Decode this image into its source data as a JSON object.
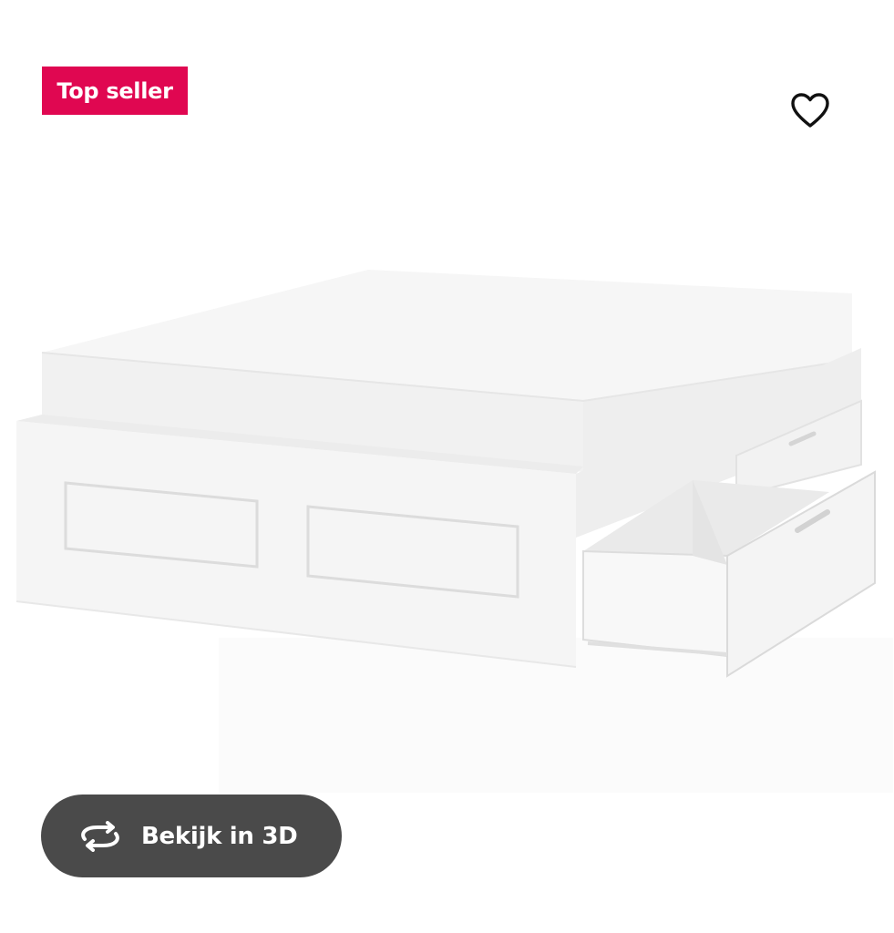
{
  "badge": {
    "label": "Top seller",
    "color": "#e00751"
  },
  "favorite": {
    "icon": "heart-outline-icon"
  },
  "product_image": {
    "alt": "Bed frame with storage drawers"
  },
  "view_3d": {
    "label": "Bekijk in 3D",
    "icon": "rotate-3d-icon",
    "color": "#4a4a4a"
  }
}
